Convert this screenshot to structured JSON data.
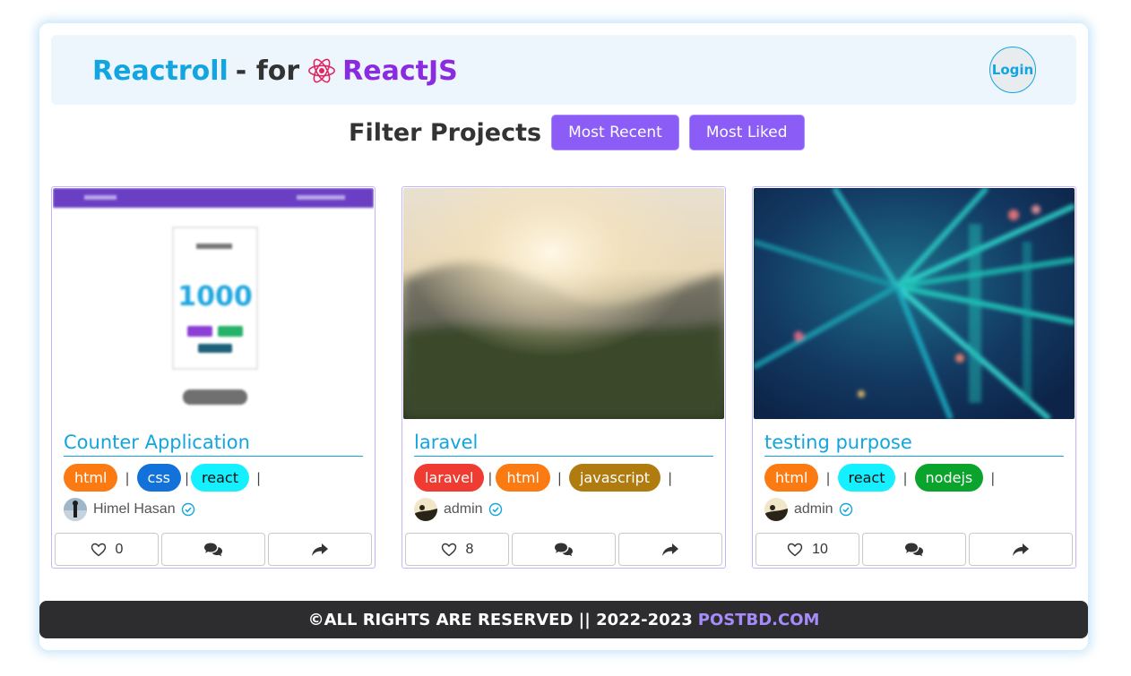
{
  "header": {
    "brand_name": "Reactroll",
    "brand_sep": "- for",
    "brand_react": "ReactJS",
    "login_label": "Login"
  },
  "filter": {
    "title": "Filter Projects",
    "buttons": [
      "Most Recent",
      "Most Liked"
    ]
  },
  "cards": [
    {
      "title": "Counter Application",
      "tags": [
        {
          "label": "html",
          "bg": "#fb7a12",
          "fg": "#ffffff"
        },
        {
          "label": "css",
          "bg": "#1272d9",
          "fg": "#ffffff"
        },
        {
          "label": "react",
          "bg": "#14f0ff",
          "fg": "#111111"
        }
      ],
      "author": "Himel Hasan",
      "likes": "0"
    },
    {
      "title": "laravel",
      "tags": [
        {
          "label": "laravel",
          "bg": "#ef3b32",
          "fg": "#ffffff"
        },
        {
          "label": "html",
          "bg": "#fb7a12",
          "fg": "#ffffff"
        },
        {
          "label": "javascript",
          "bg": "#b07c0f",
          "fg": "#ffffff"
        }
      ],
      "author": "admin",
      "likes": "8"
    },
    {
      "title": "testing purpose",
      "tags": [
        {
          "label": "html",
          "bg": "#fb7a12",
          "fg": "#ffffff"
        },
        {
          "label": "react",
          "bg": "#14f0ff",
          "fg": "#111111"
        },
        {
          "label": "nodejs",
          "bg": "#0aa32c",
          "fg": "#ffffff"
        }
      ],
      "author": "admin",
      "likes": "10"
    }
  ],
  "footer": {
    "text": "©ALL RIGHTS ARE RESERVED || 2022-2023",
    "link": "POSTBD.COM"
  },
  "colors": {
    "accent": "#8b5cf6",
    "brand": "#12a5df",
    "react": "#8a2be2"
  },
  "icons": [
    "react-logo-icon",
    "heart-icon",
    "comments-icon",
    "share-icon",
    "verified-icon"
  ]
}
